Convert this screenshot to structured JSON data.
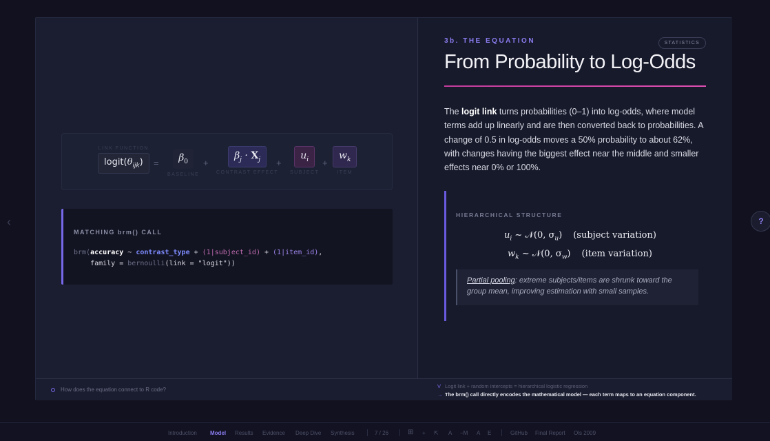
{
  "equation": {
    "lhs_label": "LINK FUNCTION",
    "lhs": "logit(θ_ijk)",
    "equals": "=",
    "terms": [
      {
        "symbol": "β0",
        "label": "BASELINE"
      },
      {
        "symbol": "βj · Xj",
        "label": "CONTRAST EFFECT"
      },
      {
        "symbol": "ui",
        "label": "SUBJECT"
      },
      {
        "symbol": "wk",
        "label": "ITEM"
      }
    ],
    "plus": "+"
  },
  "code": {
    "heading": "MATCHING brm() CALL",
    "line1": {
      "fn": "brm(",
      "resp": "accuracy",
      "tilde": " ~ ",
      "pred": "contrast_type",
      "plus1": " + ",
      "re1": "(1|subject_id)",
      "plus2": " + ",
      "re2": "(1|item_id)",
      "end": ","
    },
    "line2": {
      "indent": "    family = ",
      "fam": "bernoulli",
      "rest": "(link = \"logit\"))"
    }
  },
  "slide": {
    "section": "3b. THE EQUATION",
    "badge": "STATISTICS",
    "title": "From Probability to Log-Odds",
    "body_pre": "The ",
    "body_bold": "logit link",
    "body_post": " turns probabilities (0–1) into log-odds, where model terms add up linearly and are then converted back to probabilities. A change of 0.5 in log-odds moves a 50% probability to about 62%, with changes having the biggest effect near the middle and smaller effects near 0% or 100%.",
    "hier_heading": "HIERARCHICAL STRUCTURE",
    "math1_lhs": "u",
    "math1_sub": "i",
    "math1_dist": " ~ 𝒩(0, σ",
    "math1_sig": "u",
    "math1_close": ")",
    "math1_note": "(subject variation)",
    "math2_lhs": "w",
    "math2_sub": "k",
    "math2_dist": " ~ 𝒩(0, σ",
    "math2_sig": "w",
    "math2_close": ")",
    "math2_note": "(item variation)",
    "pooling_term": "Partial pooling",
    "pooling_text": ": extreme subjects/items are shrunk toward the group mean, improving estimation with small samples."
  },
  "footer": {
    "question": "How does the equation connect to R code?",
    "note1_mark": "V",
    "note1": "Logit link + random intercepts = hierarchical logistic regression",
    "note2_mark": "→",
    "note2": "The brm() call directly encodes the mathematical model — each term maps to an equation component."
  },
  "side": {
    "left_chevron": "‹",
    "help": "?"
  },
  "nav": {
    "items": [
      "Introduction",
      "Model",
      "Results",
      "Evidence",
      "Deep Dive",
      "Synthesis"
    ],
    "active": "Model",
    "page": "7 / 26",
    "tools": [
      "⊞",
      "+",
      "⇱",
      "A",
      "−M",
      "A",
      "E"
    ],
    "links": [
      "GitHub",
      "Final Report",
      "Ols 2009"
    ]
  }
}
